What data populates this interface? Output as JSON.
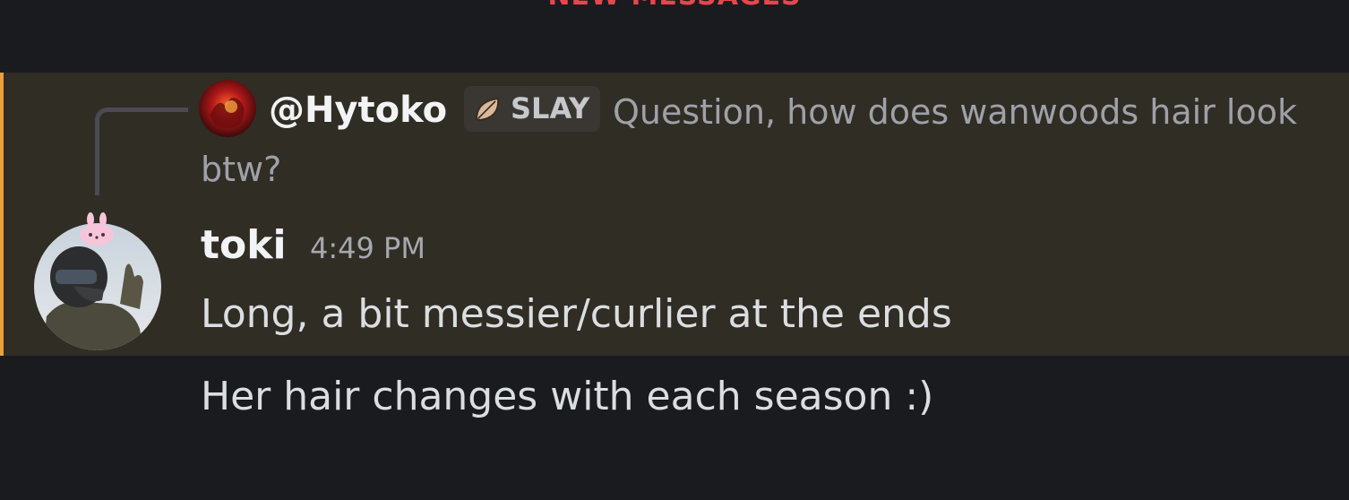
{
  "divider": {
    "label": "NEW MESSAGES",
    "color": "#e8464c"
  },
  "reply": {
    "author": "@Hytoko",
    "tag": "SLAY",
    "tag_icon": "leaf-icon",
    "text": "Question, how does wanwoods hair look btw?"
  },
  "message": {
    "author": "toki",
    "timestamp": "4:49 PM",
    "avatar_decoration": "bunny-icon",
    "lines": [
      "Long, a bit messier/curlier at the ends",
      "Her hair changes with each season :)"
    ]
  },
  "colors": {
    "background": "#1a1b1f",
    "highlight": "#302d25",
    "highlight_border": "#e9a13a"
  }
}
